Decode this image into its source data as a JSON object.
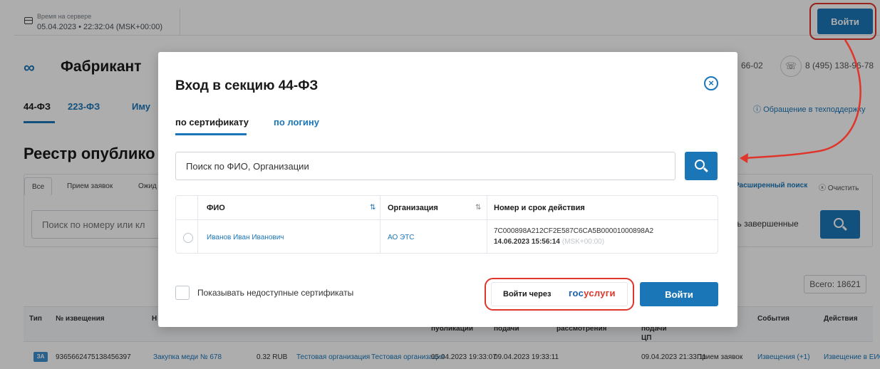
{
  "server": {
    "label": "Время на сервере",
    "time": "05.04.2023 • 22:32:04 (MSK+00:00)"
  },
  "header": {
    "login_label": "Войти",
    "logo_text": "Фабрикант",
    "phone1": "66-02",
    "phone2": "8 (495) 138-96-78",
    "support": "Обращение в техподдержку"
  },
  "nav": {
    "tabs": [
      "44-ФЗ",
      "223-ФЗ",
      "Иму"
    ]
  },
  "page": {
    "title": "Реестр опублико"
  },
  "filters": {
    "tabs": [
      "Все",
      "Прием заявок",
      "Ожид"
    ],
    "search_placeholder": "Поиск по номеру или кл",
    "advanced": "Расширенный поиск",
    "clear": "Очистить",
    "finished": "ть завершенные",
    "total": "Всего: 18621"
  },
  "table": {
    "headers": [
      "Тип",
      "№ извещения",
      "Н",
      "публикации",
      "подачи",
      "рассмотрения",
      "подачи ЦП",
      "События",
      "Действия"
    ],
    "row": {
      "type": "ЗА",
      "number": "9365662475138456397",
      "name": "Закупка меди № 678",
      "price": "0.32 RUB",
      "customer": "Тестовая организация",
      "organizer": "Тестовая организация",
      "published": "05.04.2023 19:33:07",
      "deadline": "09.04.2023 19:33:11",
      "deadline_cp": "09.04.2023 21:33:11",
      "status": "Прием заявок",
      "events": "Извещения (+1)",
      "action": "Извещение в ЕИС"
    }
  },
  "modal": {
    "title": "Вход в секцию 44-ФЗ",
    "tab_cert": "по сертификату",
    "tab_login": "по логину",
    "search_placeholder": "Поиск по ФИО, Организации",
    "columns": {
      "name": "ФИО",
      "org": "Организация",
      "number": "Номер и срок действия"
    },
    "cert": {
      "name": "Иванов Иван Иванович",
      "org": "АО ЭТС",
      "number": "7C000898A212CF2E587C6CA5B00001000898A2",
      "date": "14.06.2023 15:56:14",
      "tz": "(MSK+00:00)"
    },
    "checkbox_label": "Показывать недоступные сертификаты",
    "gos_prefix": "Войти через",
    "gos_logo_blue": "гос",
    "gos_logo_red": "услуги",
    "submit": "Войти"
  },
  "colors": {
    "accent": "#1b76b8",
    "annotation": "#e0352b"
  }
}
